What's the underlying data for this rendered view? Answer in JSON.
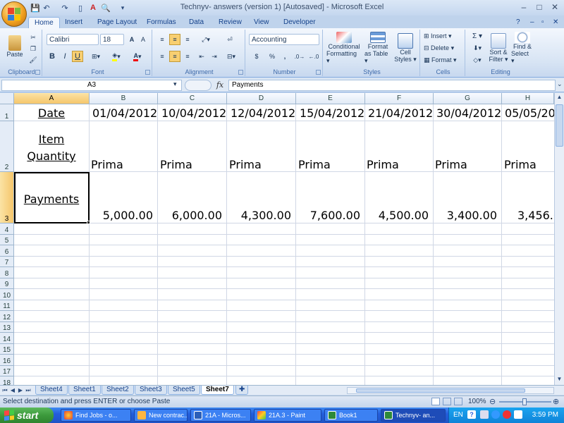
{
  "window": {
    "title": "Technyv- answers (version 1) [Autosaved] - Microsoft Excel",
    "min": "–",
    "max": "□",
    "close": "✕"
  },
  "ribbon_tabs": [
    "Home",
    "Insert",
    "Page Layout",
    "Formulas",
    "Data",
    "Review",
    "View",
    "Developer"
  ],
  "ribbon": {
    "clipboard": {
      "label": "Clipboard",
      "paste": "Paste"
    },
    "font": {
      "label": "Font",
      "name": "Calibri",
      "size": "18",
      "bold": "B",
      "italic": "I",
      "underline": "U"
    },
    "alignment": {
      "label": "Alignment"
    },
    "number": {
      "label": "Number",
      "format": "Accounting",
      "currency": "$",
      "percent": "%",
      "comma": ","
    },
    "styles": {
      "label": "Styles",
      "conditional": [
        "Conditional",
        "Formatting ▾"
      ],
      "format_table": [
        "Format",
        "as Table ▾"
      ],
      "cell_styles": [
        "Cell",
        "Styles ▾"
      ]
    },
    "cells": {
      "label": "Cells",
      "insert": "Insert ▾",
      "delete": "Delete ▾",
      "format": "Format ▾"
    },
    "editing": {
      "label": "Editing",
      "sigma": "Σ ▾",
      "sort": [
        "Sort &",
        "Filter ▾"
      ],
      "find": [
        "Find &",
        "Select ▾"
      ]
    }
  },
  "formula_bar": {
    "name_box": "A3",
    "fx": "fx",
    "content": "Payments"
  },
  "columns": [
    "A",
    "B",
    "C",
    "D",
    "E",
    "F",
    "G",
    "H"
  ],
  "rows": [
    "1",
    "2",
    "3",
    "4",
    "5",
    "6",
    "7",
    "8",
    "9",
    "10",
    "11",
    "12",
    "13",
    "14",
    "15",
    "16",
    "17",
    "18"
  ],
  "cells": {
    "a1": "Date",
    "a2_line1": "Item",
    "a2_line2": "Quantity",
    "a3": "Payments",
    "dates": [
      "01/04/2012",
      "10/04/2012",
      "12/04/2012",
      "15/04/2012",
      "21/04/2012",
      "30/04/2012",
      "05/05/20"
    ],
    "items": [
      "Prima",
      "Prima",
      "Prima",
      "Prima",
      "Prima",
      "Prima",
      "Prima"
    ],
    "payments": [
      "5,000.00",
      "6,000.00",
      "4,300.00",
      "7,600.00",
      "4,500.00",
      "3,400.00",
      "3,456.0"
    ]
  },
  "sheets": [
    "Sheet4",
    "Sheet1",
    "Sheet2",
    "Sheet3",
    "Sheet5",
    "Sheet7"
  ],
  "active_sheet": "Sheet7",
  "status": {
    "message": "Select destination and press ENTER or choose Paste",
    "zoom": "100%"
  },
  "taskbar": {
    "start": "start",
    "items": [
      "Find Jobs - o...",
      "New contrac...",
      "21A - Micros...",
      "21A.3 - Paint",
      "Book1",
      "Technyv- an..."
    ],
    "lang": "EN",
    "clock": "3:59 PM"
  },
  "colors": {
    "selection": "#000000",
    "header_highlight": "#f5c66b",
    "taskbar": "#245edb",
    "start": "#3c9a3c"
  }
}
